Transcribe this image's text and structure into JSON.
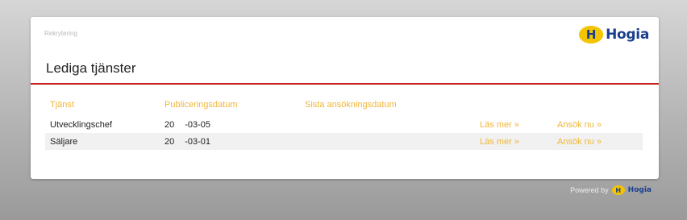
{
  "breadcrumb": "Rekrytering",
  "brand": {
    "mark": "H",
    "name": "Hogia",
    "color": "#1a3f8f",
    "accent": "#f3c400"
  },
  "page_title": "Lediga tjänster",
  "colors": {
    "rule": "#c4201c",
    "link": "#f0b63a"
  },
  "table": {
    "headers": {
      "title": "Tjänst",
      "published": "Publiceringsdatum",
      "last_date": "Sista ansökningsdatum"
    },
    "rows": [
      {
        "title": "Utvecklingschef",
        "date_prefix": "20",
        "date_suffix": "-03-05",
        "read_more": "Läs mer »",
        "apply": "Ansök nu »"
      },
      {
        "title": "Säljare",
        "date_prefix": "20",
        "date_suffix": "-03-01",
        "read_more": "Läs mer »",
        "apply": "Ansök nu »"
      }
    ]
  },
  "footer": {
    "powered_by": "Powered by",
    "mark": "H",
    "name": "Hogia"
  }
}
